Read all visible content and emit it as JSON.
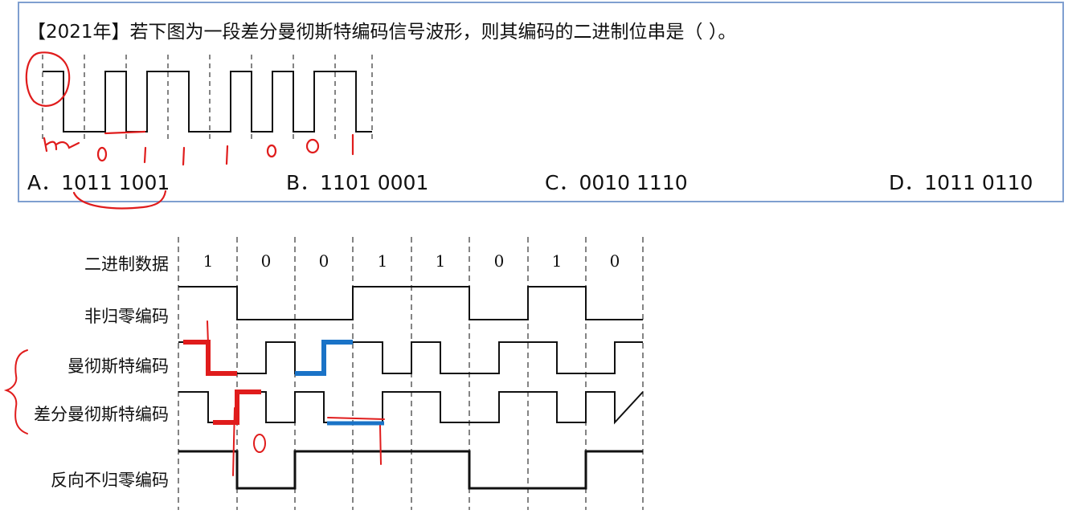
{
  "question": {
    "text": "【2021年】若下图为一段差分曼彻斯特编码信号波形，则其编码的二进制位串是（   ）。",
    "options": [
      {
        "label": "A．1011 1001"
      },
      {
        "label": "B．1101 0001"
      },
      {
        "label": "C．0010 1110"
      },
      {
        "label": "D．1011 0110"
      }
    ]
  },
  "reference": {
    "rows": [
      {
        "label": "二进制数据"
      },
      {
        "label": "非归零编码"
      },
      {
        "label": "曼彻斯特编码"
      },
      {
        "label": "差分曼彻斯特编码"
      },
      {
        "label": "反向不归零编码"
      }
    ],
    "bits": [
      "1",
      "0",
      "0",
      "1",
      "1",
      "0",
      "1",
      "0"
    ]
  },
  "colors": {
    "border": "#7f9fd0",
    "ink_red": "#e01c1c",
    "ink_blue": "#1a73c7",
    "wave": "#111111"
  }
}
